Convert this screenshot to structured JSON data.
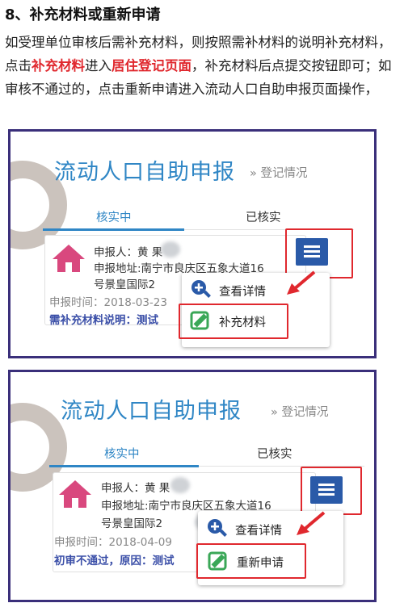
{
  "doc": {
    "title": "8、补充材料或重新申请",
    "p_part1": "如受理单位审核后需补充材料，则按照需补材料的说明补充材料，点击",
    "p_red1": "补充材料",
    "p_part2": "进入",
    "p_red2": "居住登记页面",
    "p_part3": "，补充材料后点提交按钮即可；如审核不通过的，点击重新申请进入流动人口自助申报页面操作，"
  },
  "panels": [
    {
      "app_title": "流动人口自助申报",
      "breadcrumb": "» 登记情况",
      "tabs": [
        "核实中",
        "已核实"
      ],
      "record": {
        "name": "申报人：黄 果",
        "address": "申报地址:南宁市良庆区五象大道16",
        "address2": "号景皇国际2",
        "time": "申报时间：2018-03-23",
        "note": "需补充材料说明：测试"
      },
      "menu": {
        "view_label": "查看详情",
        "action_label": "补充材料"
      }
    },
    {
      "app_title": "流动人口自助申报",
      "breadcrumb": "» 登记情况",
      "tabs": [
        "核实中",
        "已核实"
      ],
      "record": {
        "name": "申报人：黄 果",
        "address": "申报地址:南宁市良庆区五象大道16",
        "address2": "号景皇国际2",
        "time": "申报时间：2018-04-09",
        "note": "初审不通过，原因：测试"
      },
      "menu": {
        "view_label": "查看详情",
        "action_label": "重新申请"
      }
    }
  ],
  "colors": {
    "accent": "#2f86c5",
    "highlight": "#e0282e",
    "frame": "#3a2f7a",
    "menu_button": "#2a5aa8",
    "house_icon": "#d9487e",
    "icon_green": "#3aa757"
  },
  "icons": {
    "house": "house-icon",
    "menu": "list-menu-icon",
    "view": "magnifier-plus-icon",
    "action": "edit-pencil-icon"
  }
}
